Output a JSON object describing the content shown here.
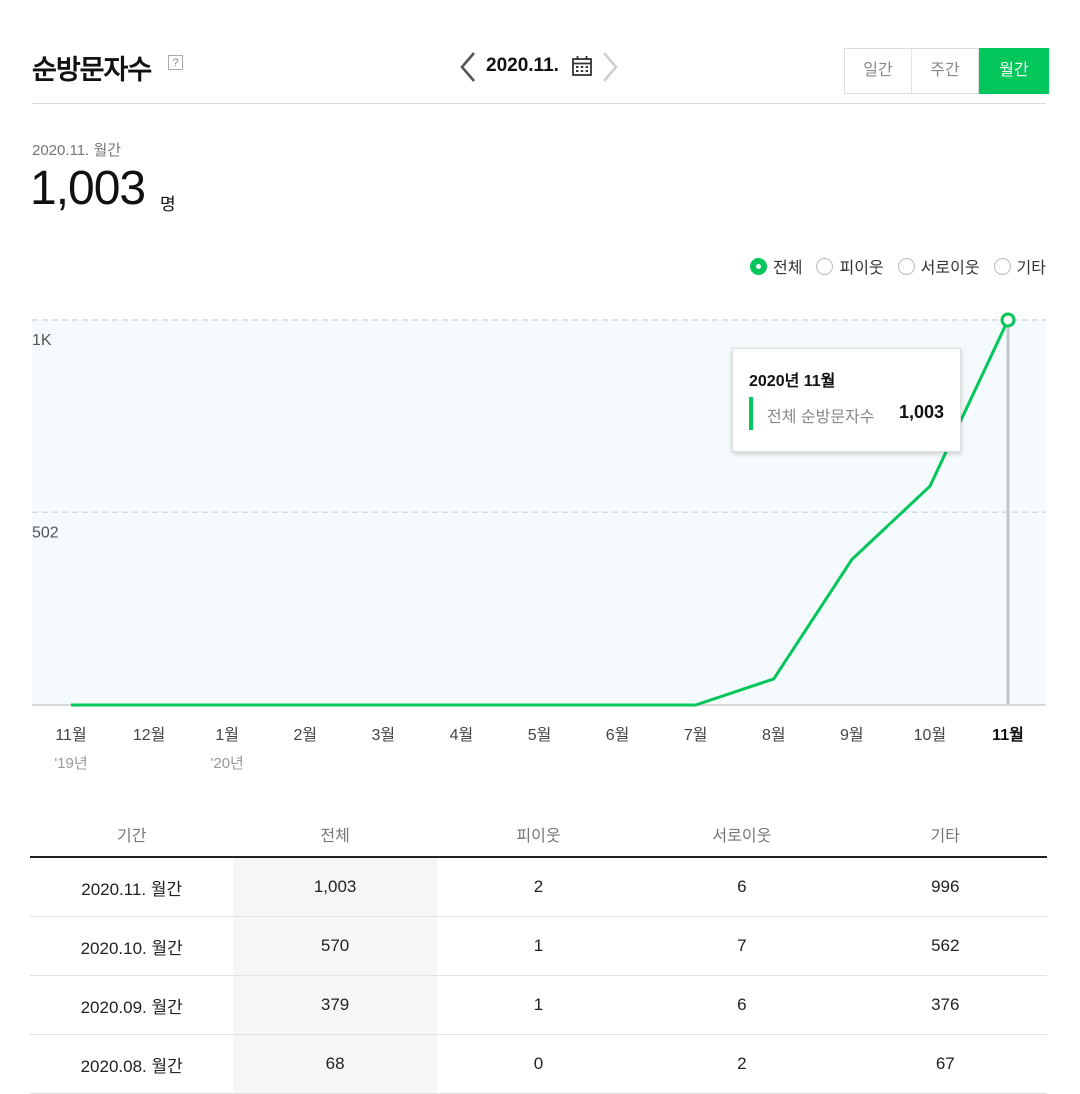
{
  "header": {
    "title": "순방문자수",
    "help_icon": "?",
    "date": "2020.11.",
    "prev_icon": "chevron-left-icon",
    "next_icon": "chevron-right-icon",
    "calendar_icon": "calendar-icon",
    "tabs": [
      {
        "label": "일간",
        "active": false
      },
      {
        "label": "주간",
        "active": false
      },
      {
        "label": "월간",
        "active": true
      }
    ]
  },
  "summary": {
    "label": "2020.11. 월간",
    "value": "1,003",
    "unit": "명"
  },
  "filters": [
    {
      "label": "전체",
      "checked": true
    },
    {
      "label": "피이웃",
      "checked": false
    },
    {
      "label": "서로이웃",
      "checked": false
    },
    {
      "label": "기타",
      "checked": false
    }
  ],
  "chart_data": {
    "type": "line",
    "x": [
      "11월",
      "12월",
      "1월",
      "2월",
      "3월",
      "4월",
      "5월",
      "6월",
      "7월",
      "8월",
      "9월",
      "10월",
      "11월"
    ],
    "year_labels": [
      {
        "index": 0,
        "label": "'19년"
      },
      {
        "index": 2,
        "label": "'20년"
      }
    ],
    "series": [
      {
        "values": [
          0,
          0,
          0,
          0,
          0,
          0,
          0,
          0,
          0,
          68,
          379,
          570,
          1003
        ],
        "color": "#03c75a"
      }
    ],
    "y_ticks": [
      {
        "value": 502,
        "label": "502"
      },
      {
        "value": 1003,
        "label": "1K"
      }
    ],
    "ylim": [
      0,
      1003
    ],
    "highlight_index": 12,
    "grid": true
  },
  "tooltip": {
    "title": "2020년 11월",
    "label": "전체 순방문자수",
    "value": "1,003"
  },
  "table": {
    "headers": [
      "기간",
      "전체",
      "피이웃",
      "서로이웃",
      "기타"
    ],
    "rows": [
      [
        "2020.11. 월간",
        "1,003",
        "2",
        "6",
        "996"
      ],
      [
        "2020.10. 월간",
        "570",
        "1",
        "7",
        "562"
      ],
      [
        "2020.09. 월간",
        "379",
        "1",
        "6",
        "376"
      ],
      [
        "2020.08. 월간",
        "68",
        "0",
        "2",
        "67"
      ]
    ]
  },
  "colors": {
    "accent": "#03c75a",
    "chart_bg": "#f5fbfd"
  }
}
